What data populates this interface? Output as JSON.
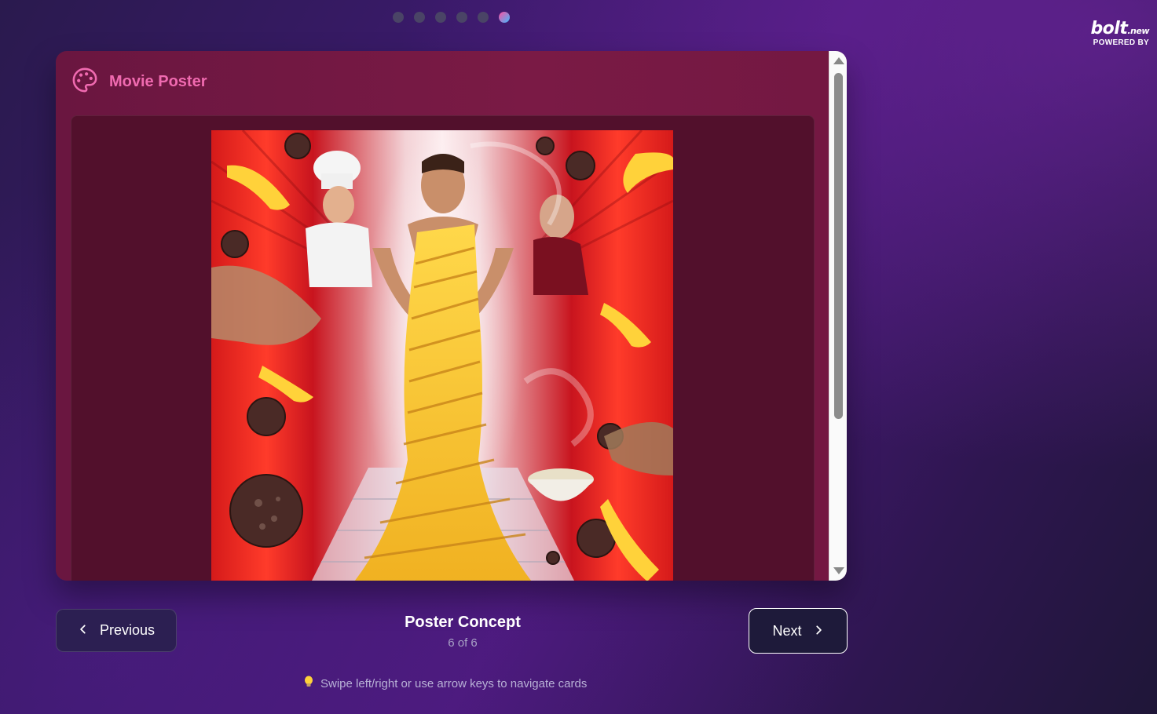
{
  "pagination": {
    "total": 6,
    "active_index": 5
  },
  "brand": {
    "name": "bolt",
    "suffix": ".new",
    "tagline": "POWERED BY"
  },
  "card": {
    "icon": "palette-icon",
    "title": "Movie Poster",
    "image": {
      "description": "Poster illustration"
    }
  },
  "navigation": {
    "previous_label": "Previous",
    "next_label": "Next",
    "current_title": "Poster Concept",
    "counter": "6 of 6"
  },
  "hint": {
    "icon": "lightbulb-icon",
    "text": "Swipe left/right or use arrow keys to navigate cards"
  },
  "colors": {
    "accent": "#f06ab0",
    "card_bg": "#7a1a45",
    "poster_box_bg": "#52102c",
    "active_dot_start": "#ff4fa0",
    "active_dot_end": "#3fb8ff"
  }
}
